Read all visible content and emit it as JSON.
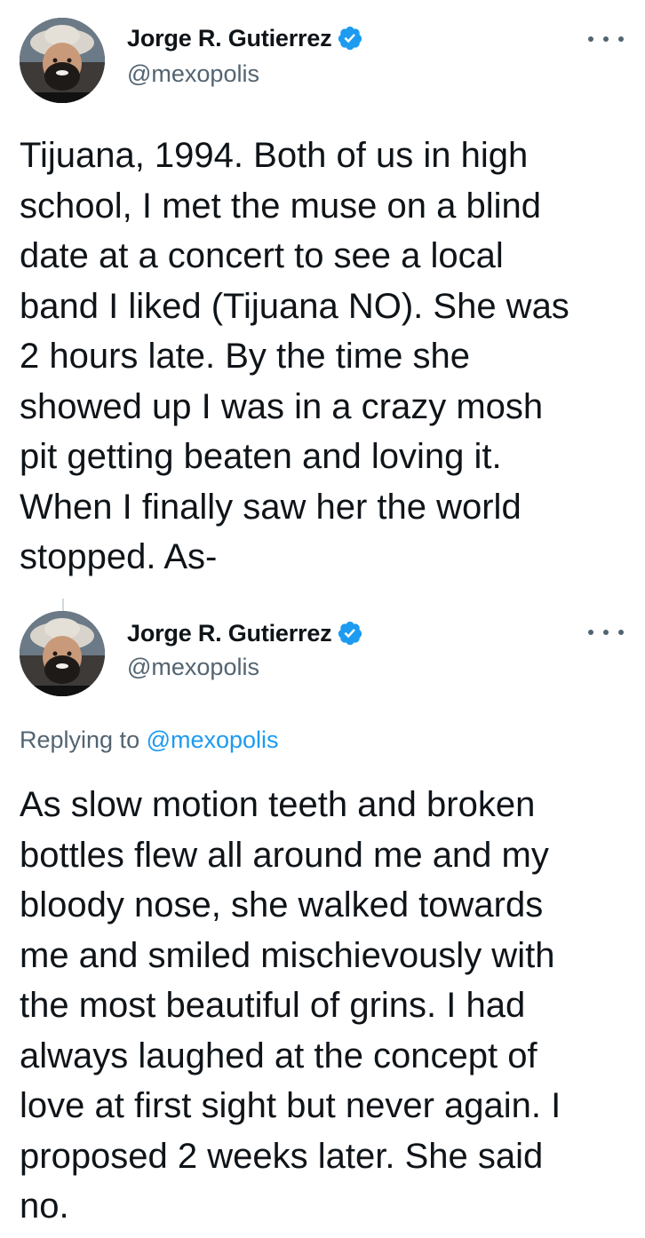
{
  "tweets": [
    {
      "author": {
        "display_name": "Jorge R. Gutierrez",
        "handle": "@mexopolis",
        "verified": true
      },
      "text": "Tijuana, 1994. Both of us in high\nschool, I met the muse on a blind\ndate at a concert to see a local\nband I liked (Tijuana NO). She was\n2 hours late. By the time she\nshowed up I was in a crazy mosh\npit getting beaten and loving it.\nWhen I finally saw her the world\nstopped. As-"
    },
    {
      "author": {
        "display_name": "Jorge R. Gutierrez",
        "handle": "@mexopolis",
        "verified": true
      },
      "replying_to_prefix": "Replying to ",
      "replying_to_handle": "@mexopolis",
      "text": "As slow motion teeth and broken\nbottles flew all around me and my\nbloody nose, she walked towards\nme and smiled mischievously with\nthe most beautiful of grins. I had\nalways laughed at the concept of\nlove at first sight but never again. I\nproposed 2 weeks later. She said\nno."
    }
  ],
  "colors": {
    "text_primary": "#0f1419",
    "text_secondary": "#536471",
    "link": "#1d9bf0",
    "verified_badge": "#1d9bf0",
    "thread_line": "#cfd9de"
  },
  "icons": {
    "verified": "verified-badge-icon",
    "more": "more-horizontal-icon",
    "avatar": "profile-photo"
  }
}
